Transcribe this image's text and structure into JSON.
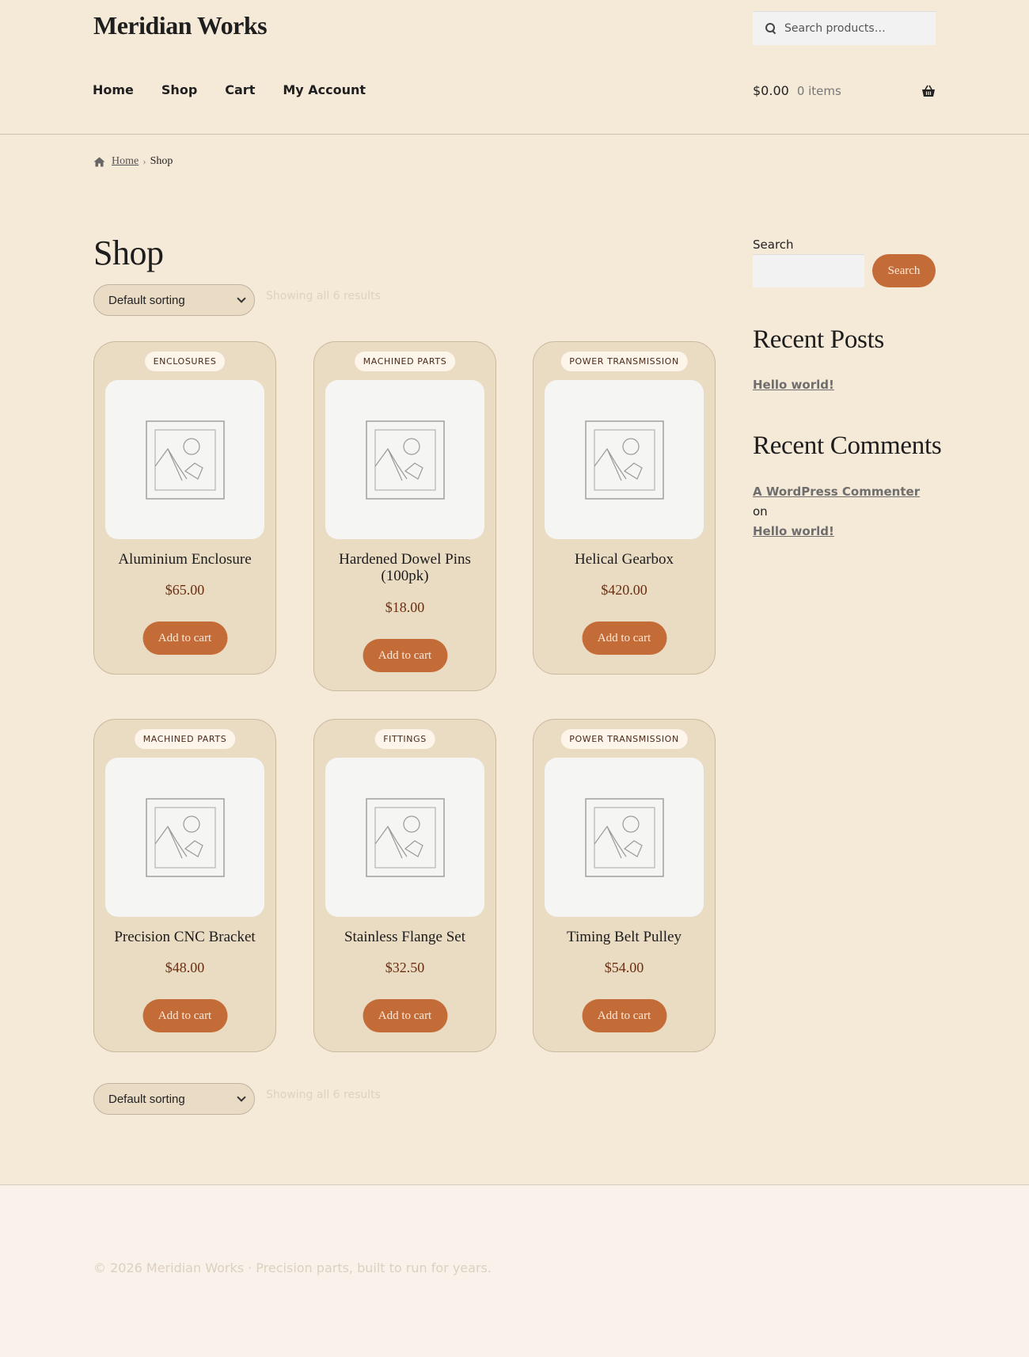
{
  "site": {
    "title": "Meridian Works"
  },
  "header_search": {
    "placeholder": "Search products…",
    "icon": "search-icon"
  },
  "nav": {
    "items": [
      "Home",
      "Shop",
      "Cart",
      "My Account"
    ]
  },
  "mini_cart": {
    "amount": "$0.00",
    "items": "0 items",
    "icon": "basket-icon"
  },
  "breadcrumb": {
    "home": "Home",
    "separator": "›",
    "current": "Shop"
  },
  "page": {
    "title": "Shop"
  },
  "sorting": {
    "selected": "Default sorting",
    "result_count": "Showing all 6 results"
  },
  "products": [
    {
      "category": "ENCLOSURES",
      "name": "Aluminium Enclosure",
      "price": "$65.00",
      "button": "Add to cart"
    },
    {
      "category": "MACHINED PARTS",
      "name": "Hardened Dowel Pins (100pk)",
      "price": "$18.00",
      "button": "Add to cart"
    },
    {
      "category": "POWER TRANSMISSION",
      "name": "Helical Gearbox",
      "price": "$420.00",
      "button": "Add to cart"
    },
    {
      "category": "MACHINED PARTS",
      "name": "Precision CNC Bracket",
      "price": "$48.00",
      "button": "Add to cart"
    },
    {
      "category": "FITTINGS",
      "name": "Stainless Flange Set",
      "price": "$32.50",
      "button": "Add to cart"
    },
    {
      "category": "POWER TRANSMISSION",
      "name": "Timing Belt Pulley",
      "price": "$54.00",
      "button": "Add to cart"
    }
  ],
  "sidebar": {
    "search_label": "Search",
    "search_button": "Search",
    "recent_posts_title": "Recent Posts",
    "recent_posts": [
      "Hello world!"
    ],
    "recent_comments_title": "Recent Comments",
    "recent_comment": {
      "author": "A WordPress Commenter",
      "joiner": "on",
      "post": "Hello world!"
    }
  },
  "footer": {
    "text": "© 2026 Meridian Works · Precision parts, built to run for years."
  },
  "colors": {
    "background": "#f5e9d8",
    "card": "#eadbc3",
    "accent": "#c46c37",
    "price": "#6b2f10"
  }
}
